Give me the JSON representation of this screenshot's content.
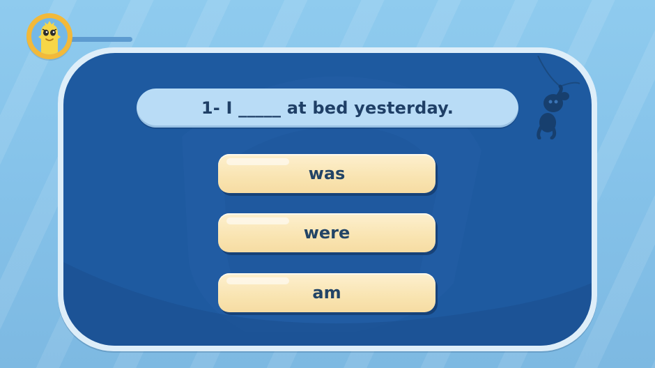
{
  "player": {
    "avatar_icon": "yellow-monster-avatar-icon",
    "progress_fraction": 0.0
  },
  "question": {
    "text": "1- I _____ at bed yesterday."
  },
  "answers": [
    {
      "label": "was"
    },
    {
      "label": "were"
    },
    {
      "label": "am"
    }
  ],
  "decor": {
    "hanging_character_icon": "hanging-monkey-silhouette-icon",
    "watermark_icon": "shield-logo-watermark-icon"
  },
  "colors": {
    "background": "#87c6ec",
    "board_frame": "#deeef9",
    "board_fill": "#1e5aa0",
    "question_bar": "#b9dcf6",
    "answer_button": "#f9e4b1",
    "text_dark": "#1f3f66",
    "avatar_ring": "#f2b93a"
  }
}
